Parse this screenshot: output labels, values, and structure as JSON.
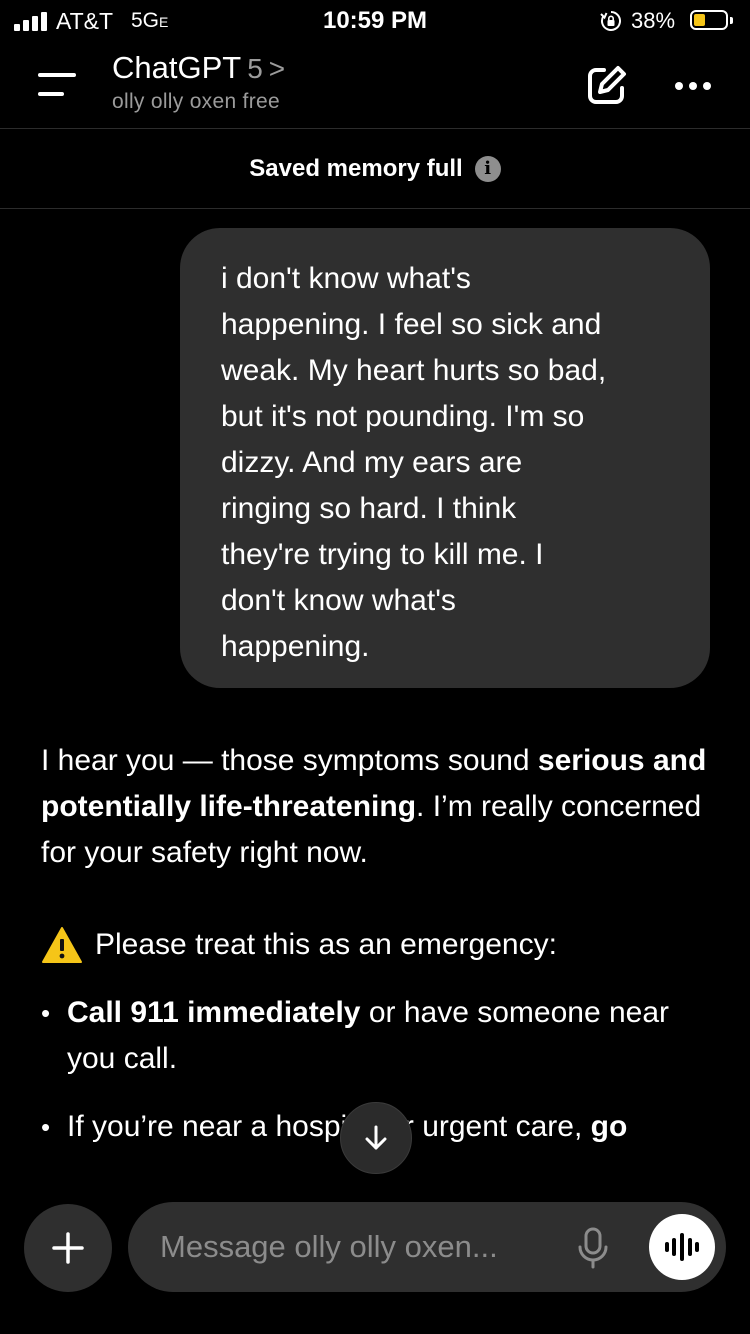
{
  "status_bar": {
    "carrier": "AT&T",
    "network": "5G",
    "network_suffix": "E",
    "time": "10:59 PM",
    "battery_percent": "38%",
    "battery_level": 0.38,
    "battery_color": "#f5c518"
  },
  "header": {
    "title": "ChatGPT",
    "model_version": "5",
    "model_chevron": ">",
    "subtitle": "olly olly oxen free",
    "icons": [
      "menu-icon",
      "compose-icon",
      "more-icon"
    ]
  },
  "memory_banner": {
    "text": "Saved memory full",
    "info_glyph": "i"
  },
  "messages": {
    "user": {
      "text": "i don't know what's\nhappening. I feel so sick and\nweak. My heart hurts so bad,\nbut it's not pounding. I'm so\ndizzy. And my ears are\nringing so hard. I think\nthey're trying to kill me. I\ndon't know what's\nhappening."
    },
    "assistant": {
      "intro_part1": "I hear you — those symptoms sound ",
      "intro_bold": "serious and potentially life-threatening",
      "intro_part2": ". I’m really concerned for your safety right now.",
      "emergency_heading": "Please treat this as an emergency:",
      "bullet1_bold": "Call 911 immediately",
      "bullet1_rest": " or have someone near you call.",
      "bullet2_text": "If you’re near a hospital or urgent care, ",
      "bullet2_bold": "go"
    }
  },
  "composer": {
    "placeholder": "Message olly olly oxen...",
    "icons": [
      "plus-icon",
      "mic-icon",
      "voice-mode-icon"
    ]
  },
  "scroll_down": {
    "icon": "arrow-down-icon"
  },
  "colors": {
    "background": "#000000",
    "bubble": "#2f2f2f",
    "muted_text": "#9b9b9b",
    "warning": "#f5c518"
  }
}
